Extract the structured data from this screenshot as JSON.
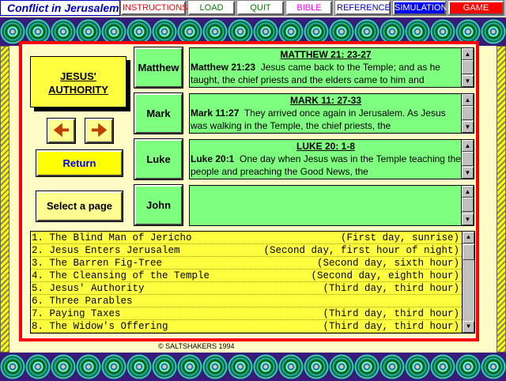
{
  "app": {
    "title": "Conflict in Jerusalem"
  },
  "menu": [
    {
      "label": "INSTRUCTIONS",
      "color": "#ff0000",
      "bg": "#ffffff"
    },
    {
      "label": "LOAD",
      "color": "#008000",
      "bg": "#ffffff"
    },
    {
      "label": "QUIT",
      "color": "#008000",
      "bg": "#ffffff"
    },
    {
      "label": "BIBLE",
      "color": "#ff00ff",
      "bg": "#ffffff"
    },
    {
      "label": "REFERENCE",
      "color": "#0000c0",
      "bg": "#ffffff"
    },
    {
      "label": "SIMULATION",
      "color": "#ffffff",
      "bg": "#0000ff"
    },
    {
      "label": "GAME",
      "color": "#ffffff",
      "bg": "#ff0000"
    }
  ],
  "page_title": "JESUS' AUTHORITY",
  "controls": {
    "prev_icon": "arrow-left-icon",
    "next_icon": "arrow-right-icon",
    "return": "Return",
    "select_page": "Select a page"
  },
  "gospels": [
    {
      "button": "Matthew",
      "title": "MATTHEW 21: 23-27",
      "ref": "Matthew 21:23",
      "text": "Jesus came back to the Temple; and as he taught, the chief priests and the elders came to him and"
    },
    {
      "button": "Mark",
      "title": "MARK 11: 27-33",
      "ref": "Mark 11:27",
      "text": "They arrived once again in Jerusalem. As Jesus was walking in the Temple, the chief priests, the"
    },
    {
      "button": "Luke",
      "title": "LUKE 20: 1-8",
      "ref": "Luke 20:1",
      "text": "One day when Jesus was in the Temple teaching the people and preaching the Good News, the"
    },
    {
      "button": "John",
      "title": "",
      "ref": "",
      "text": ""
    }
  ],
  "pages": [
    {
      "name": "1. The Blind Man of Jericho",
      "time": "(First day, sunrise)"
    },
    {
      "name": "2. Jesus Enters Jerusalem",
      "time": "(Second day, first hour of night)"
    },
    {
      "name": "3. The Barren Fig-Tree",
      "time": "(Second day, sixth hour)"
    },
    {
      "name": "4. The Cleansing of the Temple",
      "time": "(Second day, eighth hour)"
    },
    {
      "name": "5. Jesus' Authority",
      "time": "(Third day, third hour)"
    },
    {
      "name": "6. Three Parables",
      "time": ""
    },
    {
      "name": "7. Paying Taxes",
      "time": "(Third day, third hour)"
    },
    {
      "name": "8. The Widow's Offering",
      "time": "(Third day, third hour)"
    }
  ],
  "footer": {
    "copyright": "© SALTSHAKERS 1994"
  }
}
